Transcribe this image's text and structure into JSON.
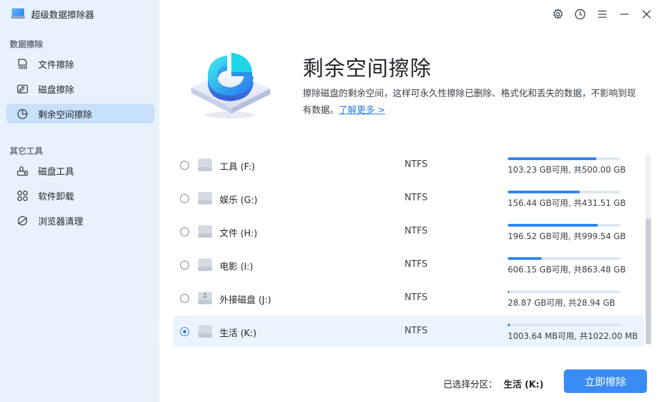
{
  "app": {
    "title": "超级数据擦除器"
  },
  "sidebar": {
    "section1": "数据擦除",
    "section2": "其它工具",
    "items": [
      {
        "label": "文件擦除",
        "icon": "file-shred-icon"
      },
      {
        "label": "磁盘擦除",
        "icon": "disk-erase-icon"
      },
      {
        "label": "剩余空间擦除",
        "icon": "pie-chart-icon",
        "active": true
      },
      {
        "label": "磁盘工具",
        "icon": "disk-tool-icon"
      },
      {
        "label": "软件卸载",
        "icon": "apps-grid-icon"
      },
      {
        "label": "浏览器清理",
        "icon": "browser-icon"
      }
    ]
  },
  "titlebar": {
    "icons": [
      "gear-icon",
      "history-icon",
      "menu-icon",
      "minimize-icon",
      "close-icon"
    ]
  },
  "header": {
    "title": "剩余空间擦除",
    "description": "擦除磁盘的剩余空间，这样可永久性擦除已删除、格式化和丢失的数据，不影响到现有数据。",
    "link": "了解更多 >"
  },
  "partitions": [
    {
      "name": "工具 (F:)",
      "fs": "NTFS",
      "capacity": "103.23 GB可用, 共500.00 GB",
      "used_fraction": 0.79,
      "type": "disk",
      "selected": false
    },
    {
      "name": "娱乐 (G:)",
      "fs": "NTFS",
      "capacity": "156.44 GB可用, 共431.51 GB",
      "used_fraction": 0.64,
      "type": "disk",
      "selected": false
    },
    {
      "name": "文件 (H:)",
      "fs": "NTFS",
      "capacity": "196.52 GB可用, 共999.54 GB",
      "used_fraction": 0.8,
      "type": "disk",
      "selected": false
    },
    {
      "name": "电影 (I:)",
      "fs": "NTFS",
      "capacity": "606.15 GB可用, 共863.48 GB",
      "used_fraction": 0.3,
      "type": "disk",
      "selected": false
    },
    {
      "name": "外接磁盘 (J:)",
      "fs": "NTFS",
      "capacity": "28.87 GB可用, 共28.94 GB",
      "used_fraction": 0.01,
      "type": "usb",
      "selected": false
    },
    {
      "name": "生活 (K:)",
      "fs": "NTFS",
      "capacity": "1003.64 MB可用, 共1022.00 MB",
      "used_fraction": 0.02,
      "type": "disk",
      "selected": true
    }
  ],
  "footer": {
    "selected_label": "已选择分区：",
    "selected_value": "生活 (K:)",
    "wipe_button": "立即擦除"
  },
  "colors": {
    "accent": "#2f86f2",
    "sidebar_bg": "#e8f2fd",
    "active_item": "#c7e0fb"
  }
}
